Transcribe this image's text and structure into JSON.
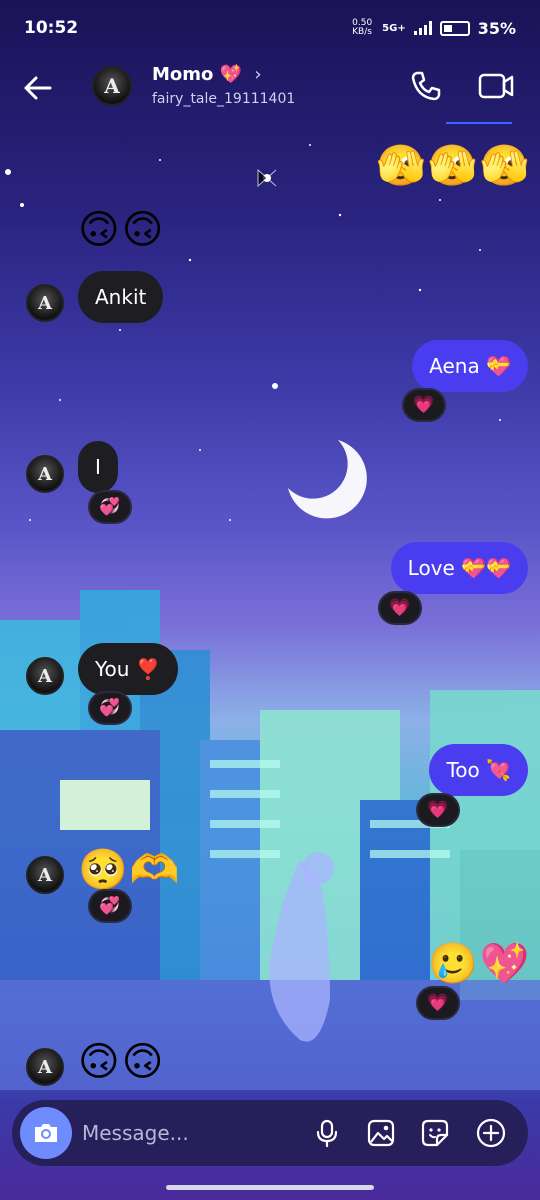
{
  "status_bar": {
    "time": "10:52",
    "net_speed": "0.50 KB/s",
    "network": "5G+",
    "battery_percent": "35%"
  },
  "header": {
    "avatar_letter": "A",
    "name": "Momo 💖",
    "chevron": "›",
    "username": "fairy_tale_19111401"
  },
  "messages": [
    {
      "side": "out",
      "kind": "emoji",
      "text": "🫣🫣🫣"
    },
    {
      "side": "in",
      "kind": "emoji",
      "text": "🙃🙃"
    },
    {
      "side": "in",
      "kind": "text",
      "text": "Ankit"
    },
    {
      "side": "out",
      "kind": "text",
      "text": "Aena 💝",
      "reaction": "💗"
    },
    {
      "side": "in",
      "kind": "text",
      "text": "I",
      "reaction": "💞"
    },
    {
      "side": "out",
      "kind": "text",
      "text": "Love 💝💝",
      "reaction": "💗"
    },
    {
      "side": "in",
      "kind": "text",
      "text": "You ❣️",
      "reaction": "💞"
    },
    {
      "side": "out",
      "kind": "text",
      "text": "Too 💘",
      "reaction": "💗"
    },
    {
      "side": "in",
      "kind": "emoji",
      "text": "🥺🫶",
      "reaction": "💞"
    },
    {
      "side": "out",
      "kind": "emoji",
      "text": "🥲💖",
      "reaction": "💗"
    },
    {
      "side": "in",
      "kind": "emoji",
      "text": "🙃🙃"
    }
  ],
  "composer": {
    "placeholder": "Message..."
  },
  "icons": [
    "back-arrow-icon",
    "phone-icon",
    "video-camera-icon",
    "camera-icon",
    "microphone-icon",
    "gallery-icon",
    "sticker-icon",
    "plus-icon"
  ],
  "colors": {
    "outgoing_bubble": "#4a3df0",
    "incoming_bubble": "#1e1e22",
    "accent": "#3d66ff"
  }
}
